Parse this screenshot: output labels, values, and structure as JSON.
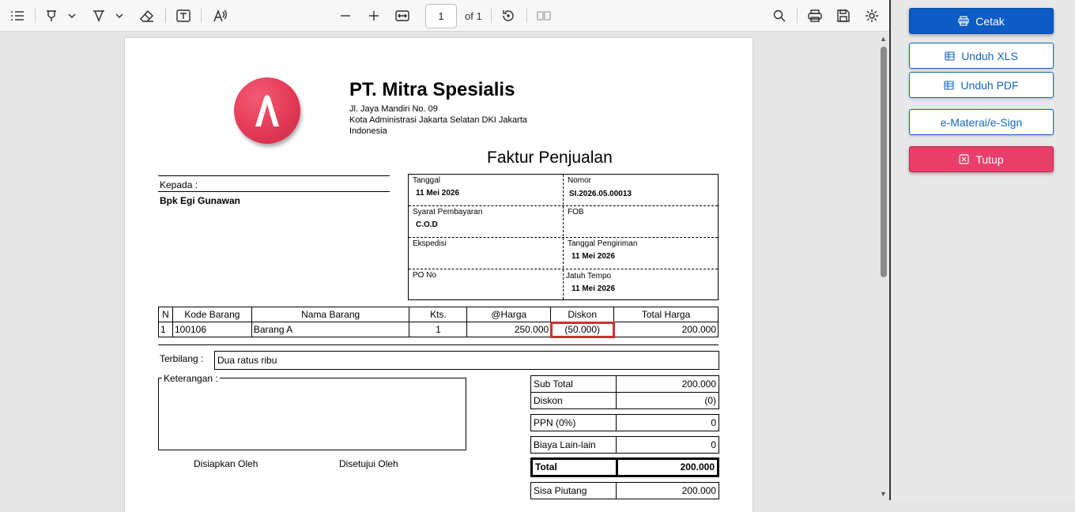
{
  "toolbar": {
    "page_value": "1",
    "page_total": "of 1",
    "icons": [
      "list-icon",
      "highlight-icon",
      "draw-icon",
      "eraser-icon",
      "text-box-icon",
      "read-aloud-icon",
      "zoom-out-icon",
      "zoom-in-icon",
      "fit-width-icon",
      "rotate-icon",
      "two-page-icon",
      "search-icon",
      "print-icon",
      "save-icon",
      "settings-icon"
    ]
  },
  "invoice": {
    "company_name": "PT. Mitra Spesialis",
    "address_line1": "Jl. Jaya Mandiri No. 09",
    "address_line2": "Kota Administrasi Jakarta Selatan DKI Jakarta",
    "address_line3": "Indonesia",
    "doc_title": "Faktur Penjualan",
    "to_label": "Kepada :",
    "to_name": "Bpk Egi Gunawan",
    "info": {
      "tanggal_label": "Tanggal",
      "tanggal_value": "11 Mei 2026",
      "nomor_label": "Nomor",
      "nomor_value": "SI.2026.05.00013",
      "syarat_label": "Syarat Pembayaran",
      "syarat_value": "C.O.D",
      "fob_label": "FOB",
      "fob_value": "",
      "ekspedisi_label": "Ekspedisi",
      "ekspedisi_value": "",
      "tgl_kirim_label": "Tanggal Pengiriman",
      "tgl_kirim_value": "11 Mei 2026",
      "po_label": "PO No",
      "po_value": "",
      "jatuh_tempo_label": "Jatuh Tempo",
      "jatuh_tempo_value": "11 Mei 2026"
    },
    "table": {
      "headers": [
        "N",
        "Kode Barang",
        "Nama Barang",
        "Kts.",
        "@Harga",
        "Diskon",
        "Total Harga"
      ],
      "rows": [
        [
          "1",
          "100106",
          "Barang A",
          "1",
          "250.000",
          "(50.000)",
          "200.000"
        ]
      ]
    },
    "terbilang_label": "Terbilang :",
    "terbilang_value": "Dua ratus ribu",
    "keterangan_label": "Keterangan :",
    "prepared_label": "Disiapkan Oleh",
    "approved_label": "Disetujui Oleh",
    "summary": {
      "subtotal_label": "Sub Total",
      "subtotal_value": "200.000",
      "diskon_label": "Diskon",
      "diskon_value": "(0)",
      "ppn_label": "PPN (0%)",
      "ppn_value": "0",
      "biaya_label": "Biaya Lain-lain",
      "biaya_value": "0",
      "total_label": "Total",
      "total_value": "200.000",
      "sisa_label": "Sisa Piutang",
      "sisa_value": "200.000"
    }
  },
  "sidebar": {
    "cetak": "Cetak",
    "unduh_xls": "Unduh XLS",
    "unduh_pdf": "Unduh PDF",
    "emeterai": "e-Materai/e-Sign",
    "tutup": "Tutup"
  },
  "colors": {
    "primary": "#0d5bc4",
    "danger": "#e8406a",
    "highlight": "#d32f2f",
    "logo": "#e33a57"
  }
}
